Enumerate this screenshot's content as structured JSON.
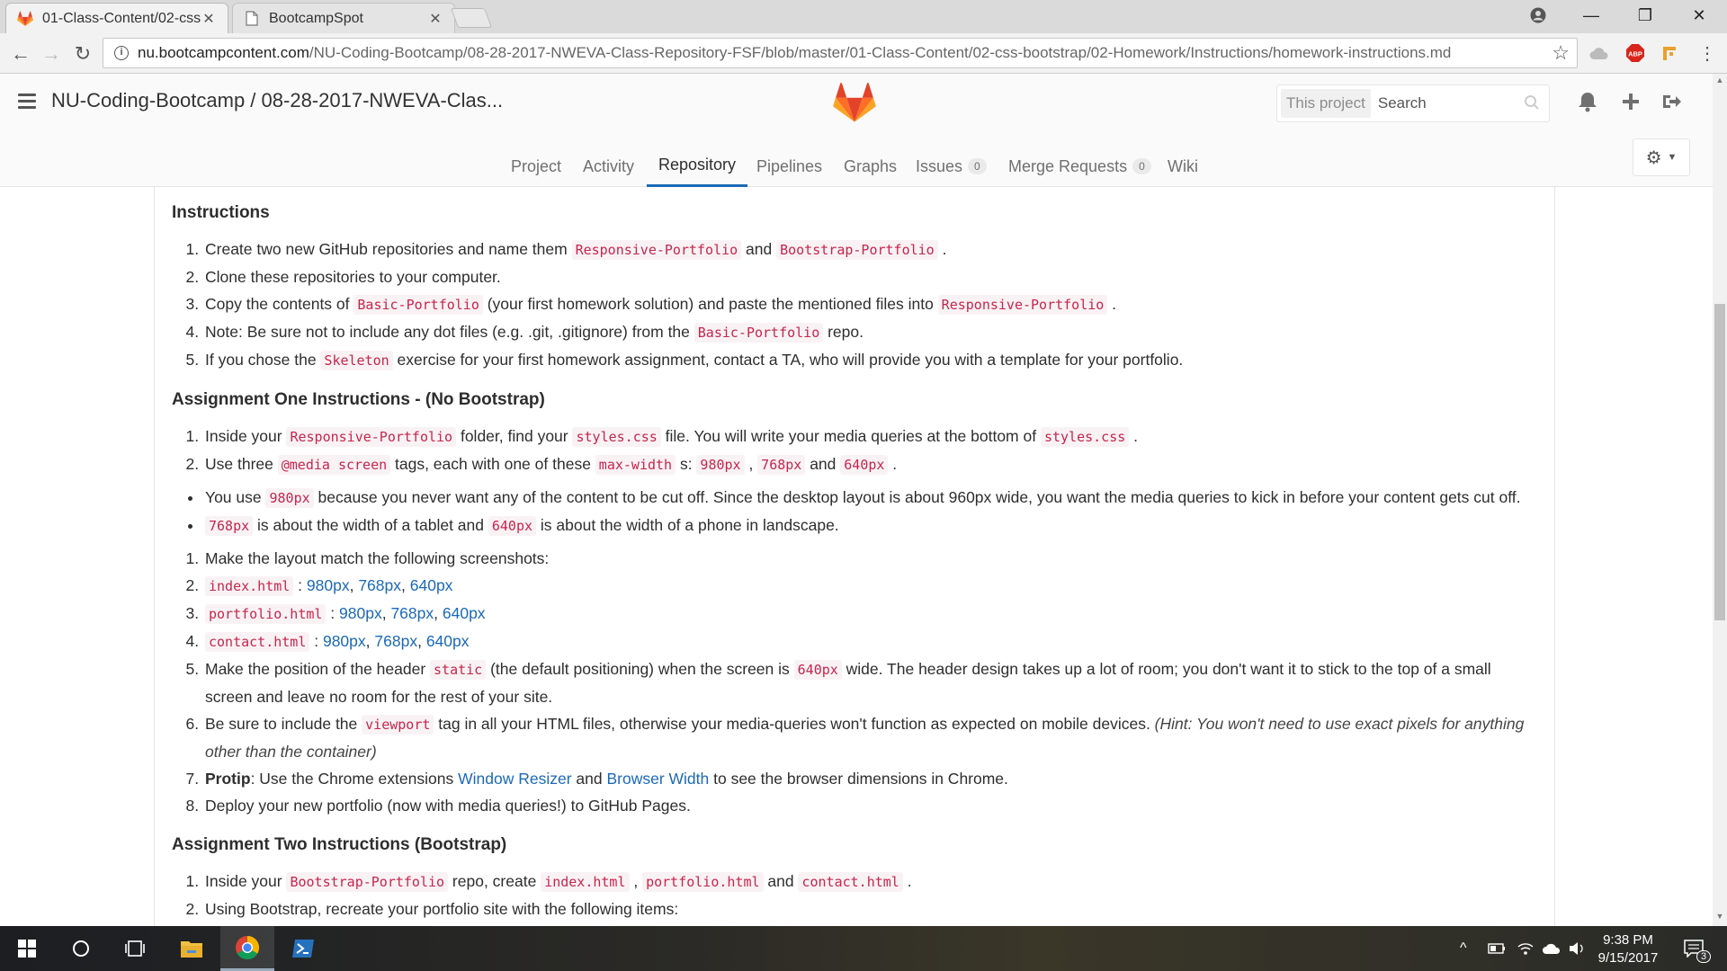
{
  "browser": {
    "tabs": [
      {
        "title": "01-Class-Content/02-css",
        "active": true
      },
      {
        "title": "BootcampSpot",
        "active": false
      }
    ],
    "url_domain": "nu.bootcampcontent.com",
    "url_path": "/NU-Coding-Bootcamp/08-28-2017-NWEVA-Class-Repository-FSF/blob/master/01-Class-Content/02-css-bootstrap/02-Homework/Instructions/homework-instructions.md",
    "extensions": {
      "abp": "ABP"
    }
  },
  "header": {
    "project_title": "NU-Coding-Bootcamp / 08-28-2017-NWEVA-Clas...",
    "search_scope": "This project",
    "search_placeholder": "Search"
  },
  "nav": {
    "project": "Project",
    "activity": "Activity",
    "repository": "Repository",
    "pipelines": "Pipelines",
    "graphs": "Graphs",
    "issues": "Issues",
    "issues_count": "0",
    "merge_requests": "Merge Requests",
    "merge_requests_count": "0",
    "wiki": "Wiki"
  },
  "doc": {
    "h_instructions": "Instructions",
    "i1_a": "Create two new GitHub repositories and name them ",
    "i1_c1": "Responsive-Portfolio",
    "i1_b": " and ",
    "i1_c2": "Bootstrap-Portfolio",
    "i1_d": " .",
    "i2": "Clone these repositories to your computer.",
    "i3_a": "Copy the contents of ",
    "i3_c1": "Basic-Portfolio",
    "i3_b": " (your first homework solution) and paste the mentioned files into ",
    "i3_c2": "Responsive-Portfolio",
    "i3_d": " .",
    "i4_a": "Note: Be sure not to include any dot files (e.g. .git, .gitignore) from the ",
    "i4_c1": "Basic-Portfolio",
    "i4_b": " repo.",
    "i5_a": "If you chose the ",
    "i5_c1": "Skeleton",
    "i5_b": " exercise for your first homework assignment, contact a TA, who will provide you with a template for your portfolio.",
    "h_one": "Assignment One Instructions - (No Bootstrap)",
    "a1_a": "Inside your ",
    "a1_c1": "Responsive-Portfolio",
    "a1_b": " folder, find your ",
    "a1_c2": "styles.css",
    "a1_c": " file. You will write your media queries at the bottom of ",
    "a1_c3": "styles.css",
    "a1_d": " .",
    "a2_a": "Use three ",
    "a2_c1": "@media screen",
    "a2_b": " tags, each with one of these ",
    "a2_c2": "max-width",
    "a2_c": " s: ",
    "a2_c3": "980px",
    "a2_d": " , ",
    "a2_c4": "768px",
    "a2_e": " and ",
    "a2_c5": "640px",
    "a2_f": " .",
    "b1_a": "You use ",
    "b1_c1": "980px",
    "b1_b": " because you never want any of the content to be cut off. Since the desktop layout is about 960px wide, you want the media queries to kick in before your content gets cut off.",
    "b2_c1": "768px",
    "b2_a": " is about the width of a tablet and ",
    "b2_c2": "640px",
    "b2_b": " is about the width of a phone in landscape.",
    "m1": "Make the layout match the following screenshots:",
    "m2_c": "index.html",
    "m3_c": "portfolio.html",
    "m4_c": "contact.html",
    "sep_colon": " : ",
    "sep_comma": ", ",
    "link_980": "980px",
    "link_768": "768px",
    "link_640": "640px",
    "m5_a": "Make the position of the header ",
    "m5_c1": "static",
    "m5_b": " (the default positioning) when the screen is ",
    "m5_c2": "640px",
    "m5_c": " wide. The header design takes up a lot of room; you don't want it to stick to the top of a small screen and leave no room for the rest of your site.",
    "m6_a": "Be sure to include the ",
    "m6_c1": "viewport",
    "m6_b": " tag in all your HTML files, otherwise your media-queries won't function as expected on mobile devices. ",
    "m6_em": "(Hint: You won't need to use exact pixels for anything other than the container)",
    "m7_b": "Protip",
    "m7_a": ": Use the Chrome extensions ",
    "m7_l1": "Window Resizer",
    "m7_c": " and ",
    "m7_l2": "Browser Width",
    "m7_d": " to see the browser dimensions in Chrome.",
    "m8": "Deploy your new portfolio (now with media queries!) to GitHub Pages.",
    "h_two": "Assignment Two Instructions (Bootstrap)",
    "t1_a": "Inside your ",
    "t1_c1": "Bootstrap-Portfolio",
    "t1_b": " repo, create ",
    "t1_c2": "index.html",
    "t1_c": " , ",
    "t1_c3": "portfolio.html",
    "t1_d": " and ",
    "t1_c4": "contact.html",
    "t1_e": " .",
    "t2": "Using Bootstrap, recreate your portfolio site with the following items:"
  },
  "taskbar": {
    "time": "9:38 PM",
    "date": "9/15/2017",
    "notifications": "3"
  },
  "colors": {
    "accent": "#1b69b6",
    "code_text": "#c7254e",
    "code_bg": "#f9f2f4",
    "gitlab_orange": "#e24329"
  }
}
